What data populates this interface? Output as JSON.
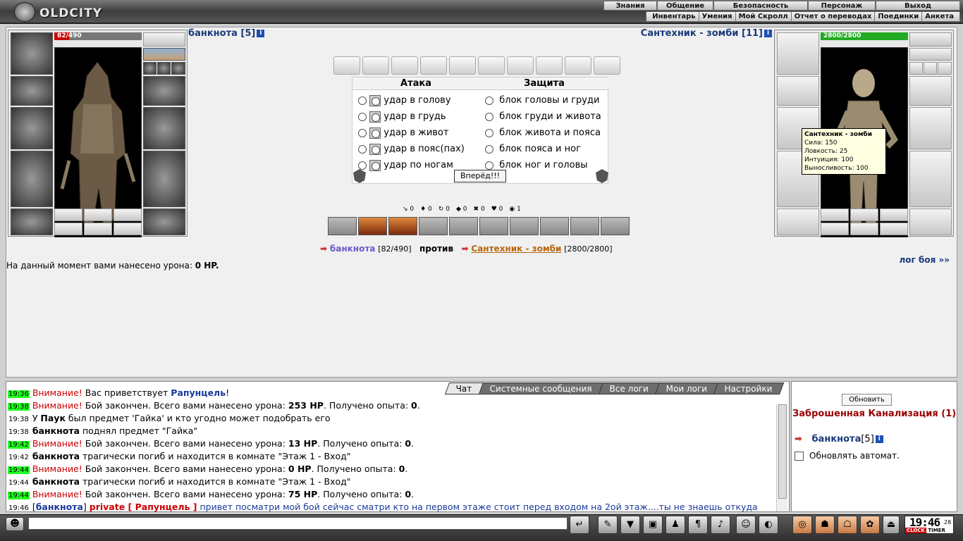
{
  "app": {
    "logo": "OLDCITY"
  },
  "menu": {
    "main": [
      "Знания",
      "Общение",
      "Безопасность",
      "Персонаж",
      "Выход"
    ],
    "sub": [
      "Инвентарь",
      "Умения",
      "Мой Скролл",
      "Отчет о переводах",
      "Поединки",
      "Анкета"
    ]
  },
  "player": {
    "name": "банкнота",
    "level": "[5]",
    "hp": "82/490",
    "hp_fraction": 0.17,
    "hp_color": "#cc0000"
  },
  "enemy": {
    "name": "Сантехник - зомби",
    "level": "[11]",
    "hp": "2800/2800",
    "hp_fraction": 1.0,
    "hp_color": "#22aa22"
  },
  "tooltip": {
    "title": "Сантехник - зомби",
    "lines": [
      "Сила: 150",
      "Ловкость: 25",
      "Интуиция: 100",
      "Выносливость: 100"
    ]
  },
  "combat": {
    "attack_header": "Атака",
    "defense_header": "Защита",
    "attacks": [
      "удар в голову",
      "удар в грудь",
      "удар в живот",
      "удар в пояс(пах)",
      "удар по ногам"
    ],
    "defenses": [
      "блок головы и груди",
      "блок груди и живота",
      "блок живота и пояса",
      "блок пояса и ног",
      "блок ног и головы"
    ],
    "go_label": "Вперёд!!!",
    "counters": [
      "0",
      "0",
      "0",
      "0",
      "0",
      "0",
      "1"
    ]
  },
  "vs": {
    "player": "банкнота",
    "player_hp": "[82/490]",
    "word": "против",
    "enemy": "Сантехник - зомби",
    "enemy_hp": "[2800/2800]"
  },
  "damage": {
    "text": "На данный момент вами нанесено урона:",
    "value": "0 HP."
  },
  "battlelog_link": "лог боя »»",
  "chat": {
    "tabs": [
      "Чат",
      "Системные сообщения",
      "Все логи",
      "Мои логи",
      "Настройки"
    ],
    "lines": [
      {
        "time": "19:36",
        "hl": true,
        "parts": [
          {
            "c": "warn",
            "t": "Внимание!"
          },
          {
            "t": " Вас приветствует "
          },
          {
            "b": true,
            "c": "blue",
            "t": "Рапунцель"
          },
          {
            "t": "!"
          }
        ]
      },
      {
        "time": "19:38",
        "hl": true,
        "parts": [
          {
            "c": "warn",
            "t": "Внимание!"
          },
          {
            "t": " Бой закончен. Всего вами нанесено урона: "
          },
          {
            "b": true,
            "t": "253 HP"
          },
          {
            "t": ". Получено опыта: "
          },
          {
            "b": true,
            "t": "0"
          },
          {
            "t": "."
          }
        ]
      },
      {
        "time": "19:38",
        "hl": false,
        "parts": [
          {
            "t": "У "
          },
          {
            "b": true,
            "t": "Паук"
          },
          {
            "t": " был предмет 'Гайка' и кто угодно может подобрать его"
          }
        ]
      },
      {
        "time": "19:38",
        "hl": false,
        "parts": [
          {
            "b": true,
            "t": "банкнота"
          },
          {
            "t": " поднял предмет \"Гайка\""
          }
        ]
      },
      {
        "time": "19:42",
        "hl": true,
        "parts": [
          {
            "c": "warn",
            "t": "Внимание!"
          },
          {
            "t": " Бой закончен. Всего вами нанесено урона: "
          },
          {
            "b": true,
            "t": "13 HP"
          },
          {
            "t": ". Получено опыта: "
          },
          {
            "b": true,
            "t": "0"
          },
          {
            "t": "."
          }
        ]
      },
      {
        "time": "19:42",
        "hl": false,
        "parts": [
          {
            "b": true,
            "t": "банкнота"
          },
          {
            "t": " трагически погиб и находится в комнате \"Этаж 1 - Вход\""
          }
        ]
      },
      {
        "time": "19:44",
        "hl": true,
        "parts": [
          {
            "c": "warn",
            "t": "Внимание!"
          },
          {
            "t": " Бой закончен. Всего вами нанесено урона: "
          },
          {
            "b": true,
            "t": "0 HP"
          },
          {
            "t": ". Получено опыта: "
          },
          {
            "b": true,
            "t": "0"
          },
          {
            "t": "."
          }
        ]
      },
      {
        "time": "19:44",
        "hl": false,
        "parts": [
          {
            "b": true,
            "t": "банкнота"
          },
          {
            "t": " трагически погиб и находится в комнате \"Этаж 1 - Вход\""
          }
        ]
      },
      {
        "time": "19:44",
        "hl": true,
        "parts": [
          {
            "c": "warn",
            "t": "Внимание!"
          },
          {
            "t": " Бой закончен. Всего вами нанесено урона: "
          },
          {
            "b": true,
            "t": "75 HP"
          },
          {
            "t": ". Получено опыта: "
          },
          {
            "b": true,
            "t": "0"
          },
          {
            "t": "."
          }
        ]
      },
      {
        "time": "19:46",
        "hl": false,
        "parts": [
          {
            "t": "["
          },
          {
            "b": true,
            "c": "blue",
            "t": "банкнота"
          },
          {
            "t": "] "
          },
          {
            "b": true,
            "c": "private",
            "t": "private [ Рапунцель ]"
          },
          {
            "c": "blue",
            "t": " привет посматри мой бой сейчас сматри кто на первом этаже стоит перед входом на 2ой этаж....ты не знаешь откуда он???"
          }
        ]
      }
    ]
  },
  "room": {
    "refresh_label": "Обновить",
    "name": "Заброшенная Канализация (1)",
    "user": "банкнота",
    "user_level": "[5]",
    "auto_label": "Обновлять автомат."
  },
  "clock": {
    "time": "19:46",
    "seconds": "28",
    "label_left": "CLOCK",
    "label_right": "TIMER"
  }
}
